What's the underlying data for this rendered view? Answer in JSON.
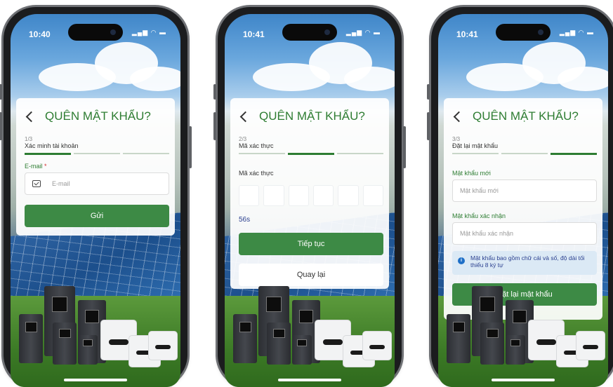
{
  "screens": [
    {
      "time": "10:40",
      "title": "QUÊN MẬT KHẨU?",
      "step_number": "1/3",
      "step_name": "Xác minh tài khoản",
      "email_label": "E-mail",
      "required_mark": "*",
      "email_placeholder": "E-mail",
      "submit_label": "Gửi"
    },
    {
      "time": "10:41",
      "title": "QUÊN MẬT KHẨU?",
      "step_number": "2/3",
      "step_name": "Mã xác thực",
      "code_label": "Mã xác thực",
      "timer": "56s",
      "continue_label": "Tiếp tục",
      "back_label": "Quay lại"
    },
    {
      "time": "10:41",
      "title": "QUÊN MẬT KHẨU?",
      "step_number": "3/3",
      "step_name": "Đặt lại mật khẩu",
      "new_password_label": "Mật khẩu mới",
      "new_password_placeholder": "Mật khẩu mới",
      "confirm_label": "Mật khẩu xác nhận",
      "confirm_placeholder": "Mật khẩu xác nhận",
      "hint": "Mật khẩu bao gồm chữ cái và số, độ dài tối thiểu 8 ký tự",
      "reset_label": "Đặt lại mật khẩu"
    }
  ],
  "colors": {
    "brand_green": "#2e7d32",
    "button_green": "#3d8a45",
    "required_red": "#d32f2f",
    "hint_bg": "#dbe9f5",
    "hint_text": "#2a3f8f"
  },
  "icons": [
    "back-chevron-icon",
    "mail-icon",
    "info-icon"
  ]
}
